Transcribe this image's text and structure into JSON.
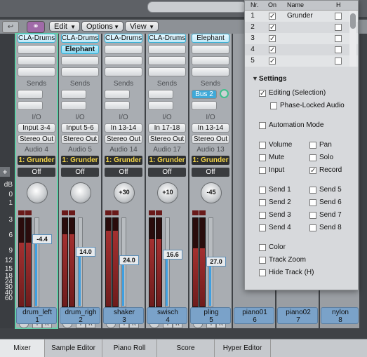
{
  "toolbar": {
    "edit_label": "Edit",
    "options_label": "Options",
    "view_label": "View"
  },
  "ruler": {
    "db_label": "dB",
    "ticks": [
      "0",
      "1",
      "3",
      "6",
      "9",
      "12",
      "15",
      "18",
      "24",
      "30",
      "40",
      "60"
    ]
  },
  "labels": {
    "sends": "Sends",
    "io": "I/O",
    "mute": "M",
    "solo": "S",
    "input": "I",
    "record": "R"
  },
  "strips": [
    {
      "plugin": "CLA-Drums",
      "plugin2": "",
      "input": "Input 3-4",
      "output": "Stereo Out",
      "audio": "Audio 4",
      "group": "1: Grunder",
      "auto": "Off",
      "pan": "",
      "fader": "-4.4",
      "name": "drum_left",
      "number": "1"
    },
    {
      "plugin": "CLA-Drums",
      "plugin2": "Elephant",
      "input": "Input 5-6",
      "output": "Stereo Out",
      "audio": "Audio 5",
      "group": "1: Grunder",
      "auto": "Off",
      "pan": "",
      "fader": "14.0",
      "name": "drum_righ",
      "number": "2"
    },
    {
      "plugin": "CLA-Drums",
      "plugin2": "",
      "input": "In 13-14",
      "output": "Stereo Out",
      "audio": "Audio 14",
      "group": "1: Grunder",
      "auto": "Off",
      "pan": "+30",
      "fader": "24.0",
      "name": "shaker",
      "number": "3"
    },
    {
      "plugin": "CLA-Drums",
      "plugin2": "",
      "input": "In 17-18",
      "output": "Stereo Out",
      "audio": "Audio 17",
      "group": "1: Grunder",
      "auto": "Off",
      "pan": "+10",
      "fader": "16.6",
      "name": "swisch",
      "number": "4"
    },
    {
      "plugin": "Elephant",
      "plugin2": "",
      "send": "Bus 2",
      "input": "In 13-14",
      "output": "Stereo Out",
      "audio": "Audio 13",
      "group": "1: Grunder",
      "auto": "Off",
      "pan": "-45",
      "fader": "27.0",
      "name": "pling",
      "number": "5"
    }
  ],
  "extra_strips": [
    {
      "name": "piano01",
      "number": "6"
    },
    {
      "name": "piano02",
      "number": "7"
    },
    {
      "name": "nylon",
      "number": "8"
    }
  ],
  "tabs": [
    "Mixer",
    "Sample Editor",
    "Piano Roll",
    "Score",
    "Hyper Editor"
  ],
  "popup": {
    "headers": {
      "nr": "Nr.",
      "on": "On",
      "name": "Name",
      "h": "H"
    },
    "groups": [
      {
        "nr": "1",
        "on": true,
        "name": "Grunder"
      },
      {
        "nr": "2",
        "on": true,
        "name": ""
      },
      {
        "nr": "3",
        "on": true,
        "name": ""
      },
      {
        "nr": "4",
        "on": true,
        "name": ""
      },
      {
        "nr": "5",
        "on": true,
        "name": ""
      }
    ],
    "settings_label": "Settings",
    "editing": {
      "label": "Editing (Selection)",
      "checked": true
    },
    "phase_locked": {
      "label": "Phase-Locked Audio",
      "checked": false
    },
    "automation_mode": {
      "label": "Automation Mode",
      "checked": false
    },
    "volume": {
      "label": "Volume",
      "checked": false
    },
    "pan": {
      "label": "Pan",
      "checked": false
    },
    "mute": {
      "label": "Mute",
      "checked": false
    },
    "solo": {
      "label": "Solo",
      "checked": false
    },
    "input": {
      "label": "Input",
      "checked": false
    },
    "record": {
      "label": "Record",
      "checked": true
    },
    "send1": {
      "label": "Send 1",
      "checked": false
    },
    "send2": {
      "label": "Send 2",
      "checked": false
    },
    "send3": {
      "label": "Send 3",
      "checked": false
    },
    "send4": {
      "label": "Send 4",
      "checked": false
    },
    "send5": {
      "label": "Send 5",
      "checked": false
    },
    "send6": {
      "label": "Send 6",
      "checked": false
    },
    "send7": {
      "label": "Send 7",
      "checked": false
    },
    "send8": {
      "label": "Send 8",
      "checked": false
    },
    "color": {
      "label": "Color",
      "checked": false
    },
    "track_zoom": {
      "label": "Track Zoom",
      "checked": false
    },
    "hide_track": {
      "label": "Hide Track (H)",
      "checked": false
    }
  }
}
